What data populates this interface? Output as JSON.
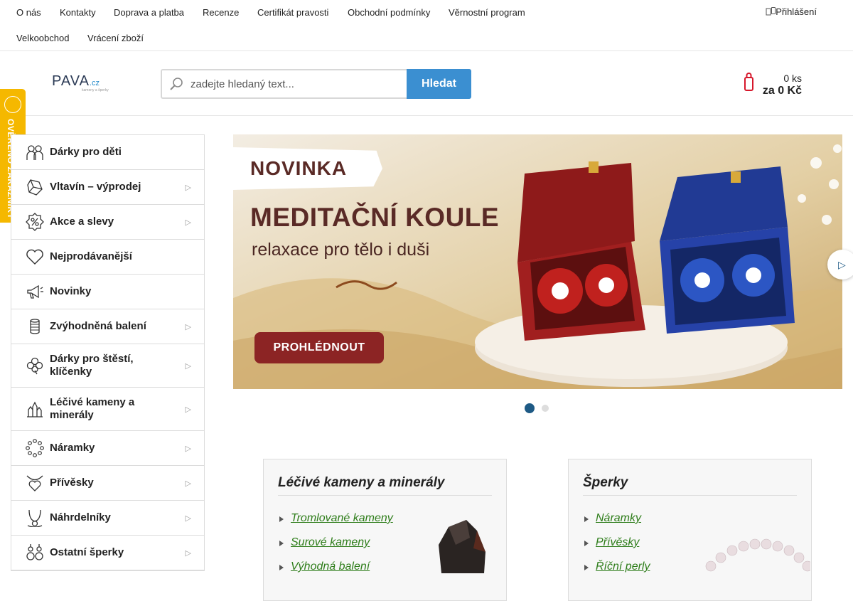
{
  "topnav": {
    "links": [
      "O nás",
      "Kontakty",
      "Doprava a platba",
      "Recenze",
      "Certifikát pravosti",
      "Obchodní podmínky",
      "Věrnostní program",
      "Velkoobchod",
      "Vrácení zboží"
    ],
    "login": "Přihlášení"
  },
  "header": {
    "logo": {
      "brand": "PAVA",
      "tld": ".cz",
      "tagline": "kameny a šperky"
    },
    "search": {
      "placeholder": "zadejte hledaný text...",
      "button": "Hledat"
    },
    "cart": {
      "count": "0 ks",
      "total": "za 0 Kč"
    }
  },
  "badge": {
    "text": "OVĚŘENO ZÁKAZNÍKY"
  },
  "sidebar": {
    "items": [
      {
        "label": "Dárky pro děti",
        "icon": "kids-icon",
        "has_sub": false
      },
      {
        "label": "Vltavín – výprodej",
        "icon": "crystal-icon",
        "has_sub": true
      },
      {
        "label": "Akce a slevy",
        "icon": "discount-icon",
        "has_sub": true
      },
      {
        "label": "Nejprodávanější",
        "icon": "heart-icon",
        "has_sub": false
      },
      {
        "label": "Novinky",
        "icon": "megaphone-icon",
        "has_sub": false
      },
      {
        "label": "Zvýhodněná balení",
        "icon": "package-icon",
        "has_sub": true
      },
      {
        "label": "Dárky pro štěstí, klíčenky",
        "icon": "clover-icon",
        "has_sub": true
      },
      {
        "label": "Léčivé kameny a minerály",
        "icon": "minerals-icon",
        "has_sub": true
      },
      {
        "label": "Náramky",
        "icon": "bracelet-icon",
        "has_sub": true
      },
      {
        "label": "Přívěsky",
        "icon": "pendant-icon",
        "has_sub": true
      },
      {
        "label": "Náhrdelníky",
        "icon": "necklace-icon",
        "has_sub": true
      },
      {
        "label": "Ostatní šperky",
        "icon": "earrings-icon",
        "has_sub": true
      }
    ]
  },
  "banner": {
    "tag": "NOVINKA",
    "title": "MEDITAČNÍ KOULE",
    "subtitle": "relaxace pro tělo i duši",
    "button": "PROHLÉDNOUT",
    "active_slide": 1,
    "slide_count": 2
  },
  "cards": [
    {
      "title": "Léčivé kameny a minerály",
      "links": [
        "Tromlované kameny",
        "Surové kameny",
        "Výhodná balení"
      ]
    },
    {
      "title": "Šperky",
      "links": [
        "Náramky",
        "Přívěsky",
        "Říční perly"
      ]
    }
  ],
  "colors": {
    "accent_blue": "#3b8fd1",
    "brand_dark": "#1e5a85",
    "cart_red": "#d6172b",
    "badge_yellow": "#f5b800",
    "banner_brown": "#5a2a26",
    "link_green": "#2e7d1a"
  }
}
